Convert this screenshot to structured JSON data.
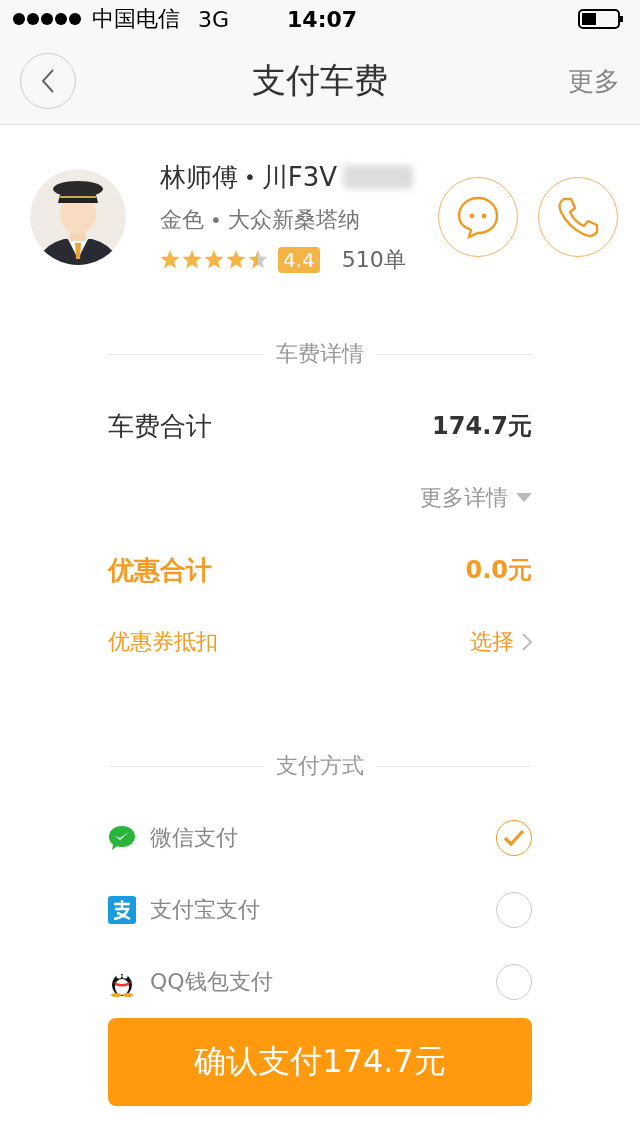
{
  "status_bar": {
    "carrier": "中国电信",
    "network": "3G",
    "time": "14:07"
  },
  "nav": {
    "title": "支付车费",
    "more": "更多"
  },
  "driver": {
    "name": "林师傅",
    "separator": "•",
    "plate": "川F3V",
    "car_color": "金色",
    "dot": "•",
    "car": "大众新桑塔纳",
    "stars": 4.5,
    "rating": "4.4",
    "orders": "510单"
  },
  "fare_section": {
    "heading": "车费详情",
    "total_label": "车费合计",
    "total_value": "174.7元",
    "details_link": "更多详情",
    "discount_label": "优惠合计",
    "discount_value": "0.0元",
    "coupon_label": "优惠券抵扣",
    "coupon_action": "选择"
  },
  "payment_section": {
    "heading": "支付方式",
    "methods": [
      {
        "kind": "wechat",
        "label": "微信支付",
        "selected": true
      },
      {
        "kind": "alipay",
        "label": "支付宝支付",
        "selected": false
      },
      {
        "kind": "qq",
        "label": "QQ钱包支付",
        "selected": false
      }
    ]
  },
  "confirm_button": "确认支付174.7元"
}
